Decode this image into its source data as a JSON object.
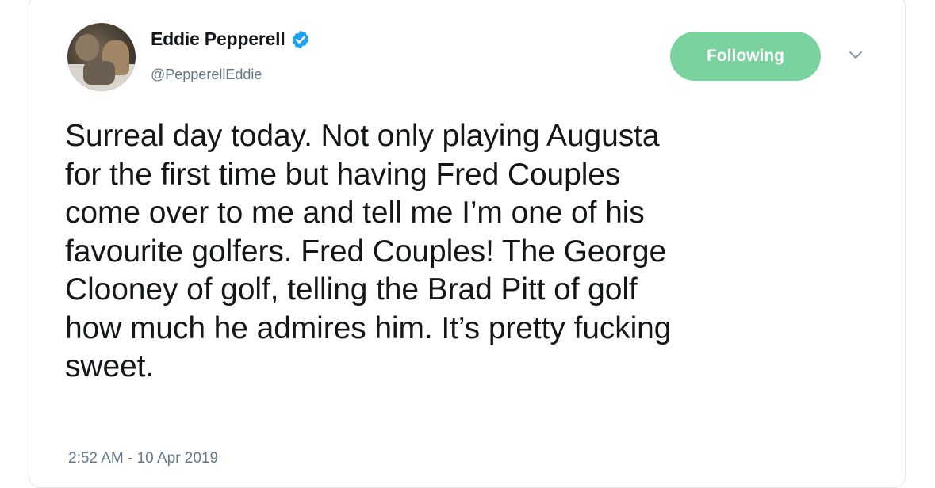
{
  "author": {
    "display_name": "Eddie Pepperell",
    "handle": "@PepperellEddie",
    "verified": true
  },
  "follow_button": {
    "label": "Following",
    "color": "#7ad39f"
  },
  "menu_icon": "chevron-down-icon",
  "tweet": {
    "text": "Surreal day today. Not only playing Augusta\nfor the first time but having Fred Couples\ncome over to me and tell me I’m one of his\nfavourite golfers. Fred Couples! The George\nClooney of golf, telling the Brad Pitt of golf\nhow much he admires him. It’s pretty fucking\nsweet.",
    "timestamp": "2:52 AM - 10 Apr 2019"
  },
  "colors": {
    "text": "#14171a",
    "secondary": "#657786",
    "verified_blue": "#1da1f2"
  }
}
